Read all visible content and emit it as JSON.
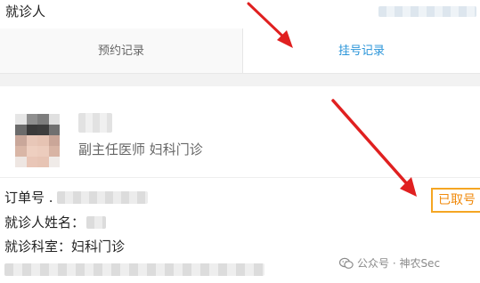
{
  "header": {
    "title": "就诊人"
  },
  "tabs": [
    {
      "label": "预约记录",
      "active": false
    },
    {
      "label": "挂号记录",
      "active": true
    }
  ],
  "doctor": {
    "title": "副主任医师 妇科门诊"
  },
  "record": {
    "order_label": "订单号 .",
    "patient_label": "就诊人姓名：",
    "dept_label": "就诊科室：",
    "dept_value": "妇科门诊",
    "status": "已取号"
  },
  "watermark": {
    "text": "公众号 · 神农Sec"
  },
  "colors": {
    "accent": "#2b95d9",
    "status": "#f5a623",
    "annotation_arrow": "#e02020"
  },
  "icons": {
    "watermark": "wechat-icon"
  }
}
